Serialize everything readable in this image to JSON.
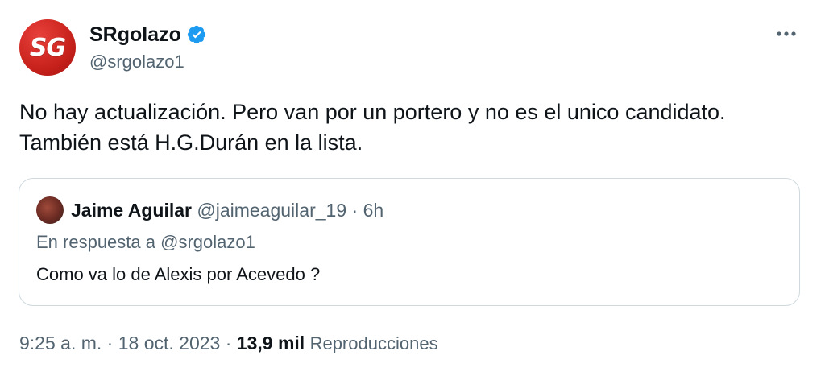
{
  "author": {
    "display_name": "SRgolazo",
    "handle": "@srgolazo1",
    "avatar_text": "SG",
    "verified": true,
    "avatar_color": "#c8221c"
  },
  "tweet": {
    "text_line1": "No hay actualización. Pero van por un portero y no es el unico candidato.",
    "text_line2": "También está H.G.Durán en la lista."
  },
  "quoted": {
    "display_name": "Jaime Aguilar",
    "handle": "@jaimeaguilar_19",
    "separator": "·",
    "time": "6h",
    "reply_prefix": "En respuesta a",
    "reply_handle": "@srgolazo1",
    "text": "Como va lo de Alexis por Acevedo ?"
  },
  "meta": {
    "time": "9:25 a. m.",
    "sep1": "·",
    "date": "18 oct. 2023",
    "sep2": "·",
    "views_count": "13,9 mil",
    "views_label": "Reproducciones"
  },
  "icons": {
    "verified": "verified-badge-icon",
    "more": "more-options-icon"
  },
  "colors": {
    "verified_blue": "#1d9bf0",
    "secondary_text": "#536471",
    "border": "#cfd9de"
  }
}
